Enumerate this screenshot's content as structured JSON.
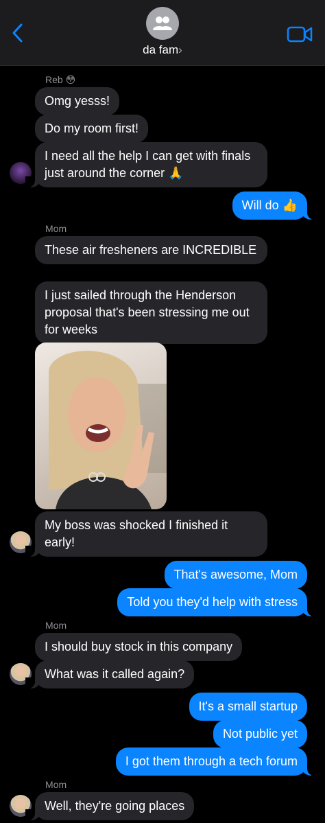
{
  "header": {
    "group_name": "da fam",
    "chevron": "›",
    "icons": [
      "back-chevron-icon",
      "group-avatar-icon",
      "video-call-icon"
    ]
  },
  "messages": [
    {
      "sender": "Reb",
      "emoji": "😳"
    },
    {
      "text": "Omg yesss!"
    },
    {
      "text": "Do my room first!"
    },
    {
      "text": "I need all the help I can get with finals just around the corner 🙏"
    },
    {
      "text": "Will do 👍"
    },
    {
      "sender": "Mom"
    },
    {
      "text": "These air fresheners are INCREDIBLE"
    },
    {
      "text": "I just sailed through the Henderson proposal that's been stressing me out for weeks"
    },
    {
      "text": "My boss was shocked I finished it early!"
    },
    {
      "text": "That's awesome, Mom"
    },
    {
      "text": "Told you they'd help with stress"
    },
    {
      "sender": "Mom"
    },
    {
      "text": "I should buy stock in this company"
    },
    {
      "text": "What was it called again?"
    },
    {
      "text": "It's a small startup"
    },
    {
      "text": "Not public yet"
    },
    {
      "text": "I got them through a tech forum"
    },
    {
      "sender": "Mom"
    },
    {
      "text": "Well, they're going places"
    }
  ],
  "colors": {
    "outgoing": "#0a84ff",
    "incoming": "#26252a",
    "background": "#000000"
  }
}
